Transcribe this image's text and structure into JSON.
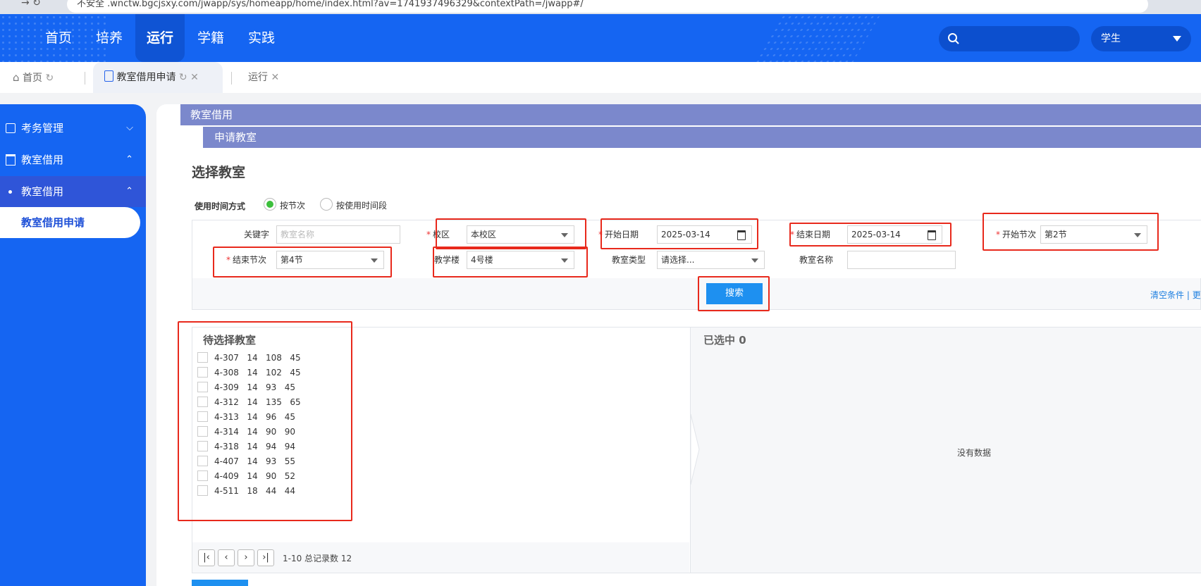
{
  "browser": {
    "url": "/jwapp/sys/homeapp/home/index.html?av=1741937496329&contextPath=/jwapp#/",
    "security_label": "不安全",
    "host_fragment": ".wnctw.bgcjsxy.com"
  },
  "topnav": {
    "items": [
      "首页",
      "培养",
      "运行",
      "学籍",
      "实践"
    ],
    "active": "运行",
    "role": "学生"
  },
  "tabs": {
    "home": "首页",
    "current": "教室借用申请",
    "other": "运行"
  },
  "sidebar": {
    "items": [
      {
        "label": "考务管理",
        "expanded": false
      },
      {
        "label": "教室借用",
        "expanded": true
      },
      {
        "label": "教室借用",
        "expanded": true
      },
      {
        "label": "教室借用申请",
        "selected": true
      }
    ]
  },
  "main": {
    "bar1": "教室借用",
    "bar2": "申请教室",
    "title": "选择教室",
    "time_mode_label": "使用时间方式",
    "time_mode_options": [
      "按节次",
      "按使用时间段"
    ],
    "time_mode_selected": "按节次",
    "fields": {
      "keyword": {
        "label": "关键字",
        "placeholder": "教室名称"
      },
      "campus": {
        "label": "校区",
        "value": "本校区"
      },
      "start_date": {
        "label": "开始日期",
        "value": "2025-03-14"
      },
      "end_date": {
        "label": "结束日期",
        "value": "2025-03-14"
      },
      "start_period": {
        "label": "开始节次",
        "value": "第2节"
      },
      "end_period": {
        "label": "结束节次",
        "value": "第4节"
      },
      "building": {
        "label": "教学楼",
        "value": "4号楼"
      },
      "room_type": {
        "label": "教室类型",
        "value": "请选择..."
      },
      "room_name": {
        "label": "教室名称",
        "value": ""
      }
    },
    "search_button": "搜索",
    "clear_link": "清空条件",
    "more_link": "| 更",
    "available_title": "待选择教室",
    "rooms": [
      "4-307   14   108   45",
      "4-308   14   102   45",
      "4-309   14   93   45",
      "4-312   14   135   65",
      "4-313   14   96   45",
      "4-314   14   90   90",
      "4-318   14   94   94",
      "4-407   14   93   55",
      "4-409   14   90   52",
      "4-511   18   44   44"
    ],
    "pagination": "1-10 总记录数 12",
    "selected_title": "已选中 0",
    "empty_text": "没有数据"
  },
  "colors": {
    "brand_blue": "#1565f2",
    "header_bar": "#7b88cc",
    "button_blue": "#1e90f0",
    "annotation_red": "#e8291c"
  }
}
